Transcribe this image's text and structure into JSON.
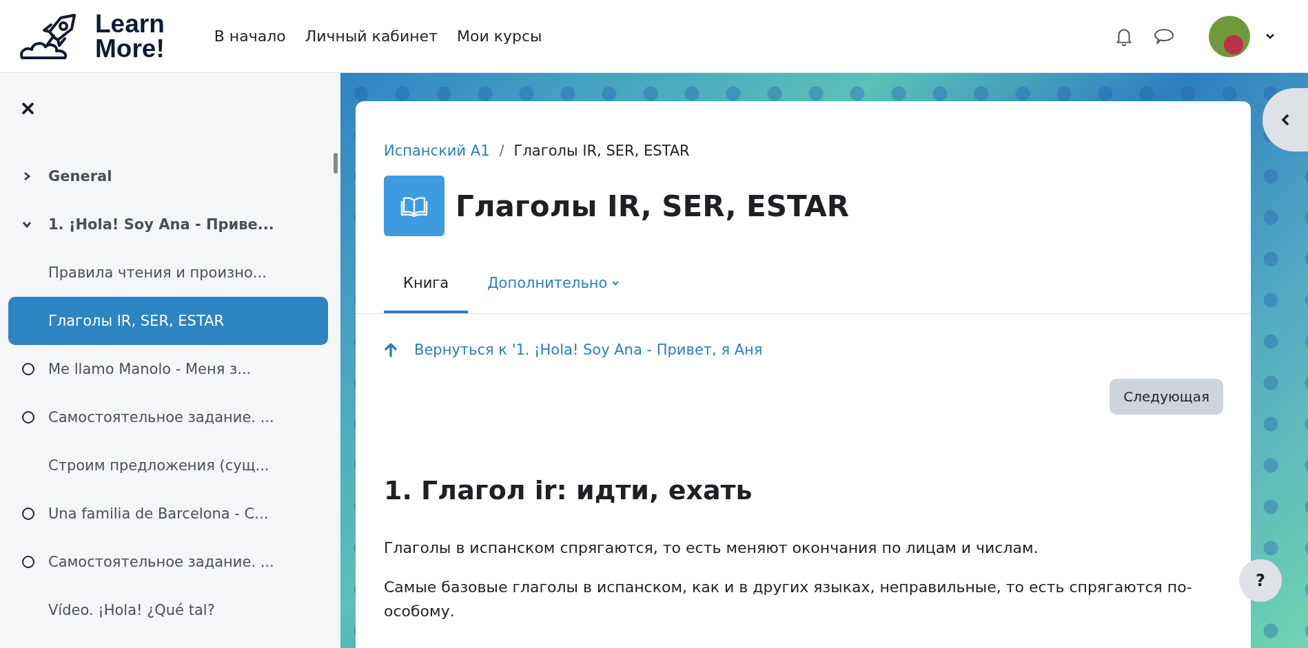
{
  "header": {
    "logo": {
      "line1": "Learn",
      "line2": "More!"
    },
    "nav": [
      {
        "label": "В начало"
      },
      {
        "label": "Личный кабинет"
      },
      {
        "label": "Мои курсы"
      }
    ]
  },
  "sidebar": {
    "items": [
      {
        "kind": "section",
        "label": "General",
        "expanded": false,
        "selected": false
      },
      {
        "kind": "section",
        "label": "1. ¡Hola! Soy Ana - Приве...",
        "expanded": true,
        "selected": false
      },
      {
        "kind": "activity",
        "label": "Правила чтения и произно...",
        "selected": false,
        "completion": false
      },
      {
        "kind": "activity",
        "label": "Глаголы IR, SER, ESTAR",
        "selected": true,
        "completion": false
      },
      {
        "kind": "activity",
        "label": "Me llamo Manolo - Меня з...",
        "selected": false,
        "completion": true
      },
      {
        "kind": "activity",
        "label": "Самостоятельное задание. ...",
        "selected": false,
        "completion": true
      },
      {
        "kind": "activity",
        "label": "Строим предложения (сущ...",
        "selected": false,
        "completion": false
      },
      {
        "kind": "activity",
        "label": "Una familia de Barcelona - C...",
        "selected": false,
        "completion": true
      },
      {
        "kind": "activity",
        "label": "Самостоятельное задание. ...",
        "selected": false,
        "completion": true
      },
      {
        "kind": "activity",
        "label": "Vídeo. ¡Hola! ¿Qué tal?",
        "selected": false,
        "completion": false
      }
    ]
  },
  "content": {
    "breadcrumb_separator": "/",
    "breadcrumb": [
      {
        "label": "Испанский А1",
        "link": true
      },
      {
        "label": "Глаголы IR, SER, ESTAR",
        "link": false
      }
    ],
    "title": "Глаголы IR, SER, ESTAR",
    "tabs": [
      {
        "label": "Книга",
        "selected": true,
        "dropdown": false
      },
      {
        "label": "Дополнительно",
        "selected": false,
        "dropdown": true
      }
    ],
    "back_link": "Вернуться к '1. ¡Hola! Soy Ana - Привет, я Аня",
    "next_button": "Следующая",
    "heading": "1. Глагол ir: идти, ехать",
    "paragraphs": [
      "Глаголы в испанском спрягаются, то есть меняют окончания по лицам и числам.",
      "Самые базовые глаголы в испанском, как и в других языках, неправильные, то есть спрягаются по-особому."
    ]
  },
  "help_button": "?"
}
